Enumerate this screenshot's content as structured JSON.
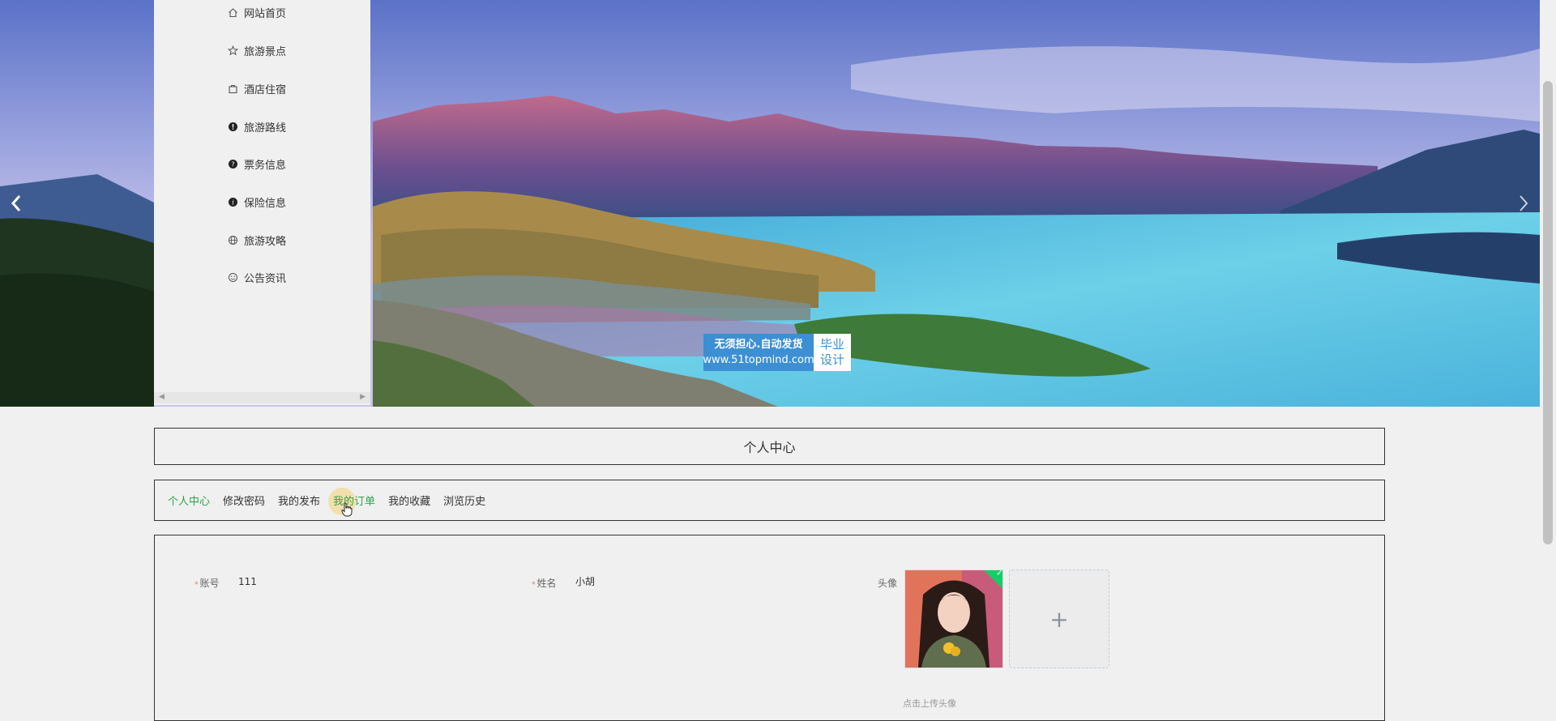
{
  "nav": {
    "items": [
      {
        "label": "网站首页",
        "icon": "home-icon"
      },
      {
        "label": "旅游景点",
        "icon": "star-icon"
      },
      {
        "label": "酒店住宿",
        "icon": "bag-icon"
      },
      {
        "label": "旅游路线",
        "icon": "alert-circle-icon"
      },
      {
        "label": "票务信息",
        "icon": "help-circle-icon"
      },
      {
        "label": "保险信息",
        "icon": "info-circle-icon"
      },
      {
        "label": "旅游攻略",
        "icon": "globe-icon"
      },
      {
        "label": "公告资讯",
        "icon": "smile-icon"
      }
    ]
  },
  "banner": {
    "prev_icon": "chevron-left-icon",
    "next_icon": "chevron-right-icon",
    "watermark": {
      "line1": "无须担心.自动发货",
      "line2": "www.51topmind.com",
      "side_line1": "毕业",
      "side_line2": "设计"
    }
  },
  "page": {
    "title": "个人中心"
  },
  "tabs": [
    {
      "label": "个人中心",
      "state": "active"
    },
    {
      "label": "修改密码",
      "state": "normal"
    },
    {
      "label": "我的发布",
      "state": "normal"
    },
    {
      "label": "我的订单",
      "state": "hover"
    },
    {
      "label": "我的收藏",
      "state": "normal"
    },
    {
      "label": "浏览历史",
      "state": "normal"
    }
  ],
  "form": {
    "account_label": "账号",
    "account_value": "111",
    "name_label": "姓名",
    "name_value": "小胡",
    "avatar_label": "头像",
    "upload_plus": "+",
    "upload_hint": "点击上传头像"
  },
  "colors": {
    "accent_green": "#2fa24a",
    "border": "#333333",
    "page_bg": "#f0f0f0",
    "watermark_blue": "#3d8fd4"
  }
}
